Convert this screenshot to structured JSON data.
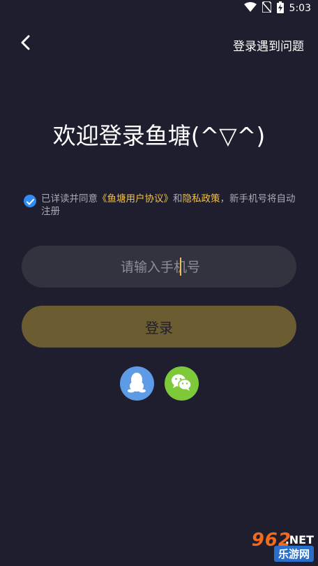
{
  "status_bar": {
    "time": "5:03",
    "icons": [
      "wifi-icon",
      "no-sim-icon",
      "battery-charging-icon"
    ]
  },
  "header": {
    "back_icon": "chevron-left-icon",
    "help_link": "登录遇到问题"
  },
  "title": "欢迎登录鱼塘(^▽^)",
  "agreement": {
    "checked": true,
    "prefix": "已详读并同意",
    "user_agreement": "《鱼塘用户协议》",
    "conjunction": "和",
    "privacy_policy": "隐私政策",
    "suffix": "，新手机号将自动注册"
  },
  "phone_input": {
    "placeholder": "请输入手机号",
    "value": ""
  },
  "login_button": {
    "label": "登录"
  },
  "social_login": [
    {
      "name": "qq",
      "icon": "qq-penguin-icon",
      "color": "#5e9be6"
    },
    {
      "name": "wechat",
      "icon": "wechat-icon",
      "color": "#7dc93a"
    }
  ],
  "watermark": {
    "number": "962",
    "suffix": ".NET",
    "text": "乐游网"
  },
  "colors": {
    "background": "#1e1e2e",
    "accent": "#f0c14b",
    "check": "#2f8cf5",
    "input_bg": "#33333f",
    "button_bg": "#6b5c31"
  }
}
